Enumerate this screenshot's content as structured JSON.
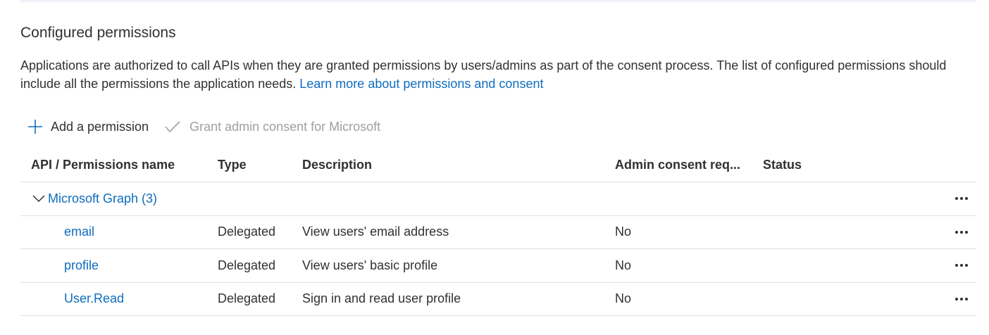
{
  "section": {
    "title": "Configured permissions",
    "description": "Applications are authorized to call APIs when they are granted permissions by users/admins as part of the consent process. The list of configured permissions should include all the permissions the application needs.",
    "learn_more_link": "Learn more about permissions and consent"
  },
  "toolbar": {
    "add_label": "Add a permission",
    "grant_label": "Grant admin consent for Microsoft",
    "add_icon": "plus-icon",
    "grant_icon": "checkmark-icon"
  },
  "table": {
    "headers": {
      "name": "API / Permissions name",
      "type": "Type",
      "description": "Description",
      "admin": "Admin consent req...",
      "status": "Status"
    },
    "group": {
      "label": "Microsoft Graph (3)"
    },
    "rows": [
      {
        "name": "email",
        "type": "Delegated",
        "description": "View users' email address",
        "admin": "No",
        "status": ""
      },
      {
        "name": "profile",
        "type": "Delegated",
        "description": "View users' basic profile",
        "admin": "No",
        "status": ""
      },
      {
        "name": "User.Read",
        "type": "Delegated",
        "description": "Sign in and read user profile",
        "admin": "No",
        "status": ""
      }
    ]
  },
  "colors": {
    "link": "#0f6cbd",
    "text": "#323130",
    "disabled": "#a19f9d",
    "divider": "#e1dfdd"
  }
}
